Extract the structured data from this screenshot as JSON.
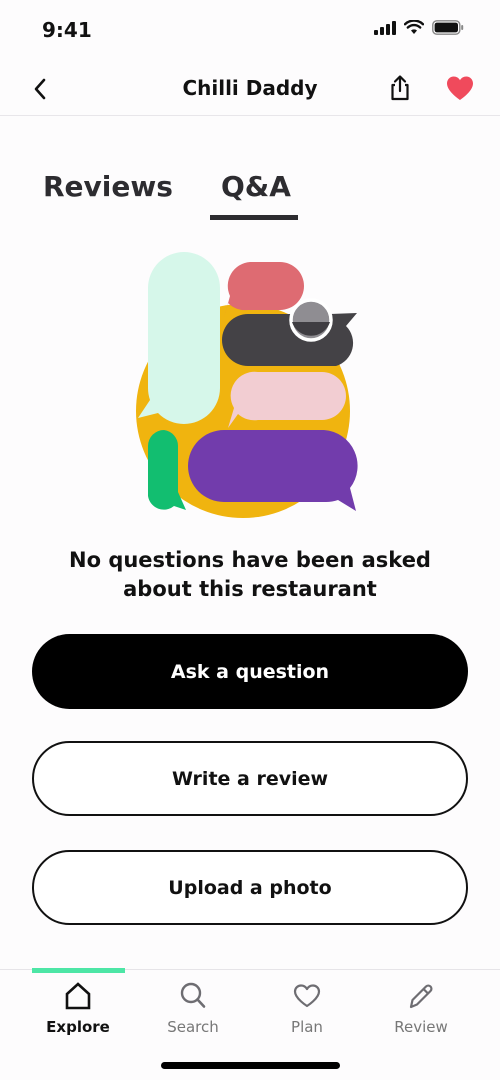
{
  "status_bar": {
    "time": "9:41",
    "icons": [
      "cellular-signal-icon",
      "wifi-icon",
      "battery-icon"
    ]
  },
  "nav": {
    "title": "Chilli Daddy",
    "back_icon": "chevron-left-icon",
    "share_icon": "share-icon",
    "favorite_icon": "heart-filled-icon",
    "favorite_color": "#f04a5c"
  },
  "tabs": {
    "items": [
      {
        "label": "Reviews",
        "active": false
      },
      {
        "label": "Q&A",
        "active": true
      }
    ]
  },
  "illustration": {
    "name": "chat-bubbles-illustration",
    "colors": {
      "circle": "#f0b40f",
      "mint": "#d6f7ea",
      "red": "#de6b72",
      "dark": "#444246",
      "pink": "#f2cdd2",
      "green": "#12be70",
      "purple": "#723cac"
    }
  },
  "empty_state": {
    "line1": "No questions have been asked",
    "line2": "about this restaurant"
  },
  "actions": {
    "ask_label": "Ask a question",
    "review_label": "Write a review",
    "photo_label": "Upload a photo"
  },
  "bottom_nav": {
    "accent": "#4de6a6",
    "items": [
      {
        "label": "Explore",
        "icon": "home-icon",
        "active": true
      },
      {
        "label": "Search",
        "icon": "search-icon",
        "active": false
      },
      {
        "label": "Plan",
        "icon": "heart-outline-icon",
        "active": false
      },
      {
        "label": "Review",
        "icon": "pencil-icon",
        "active": false
      }
    ]
  }
}
